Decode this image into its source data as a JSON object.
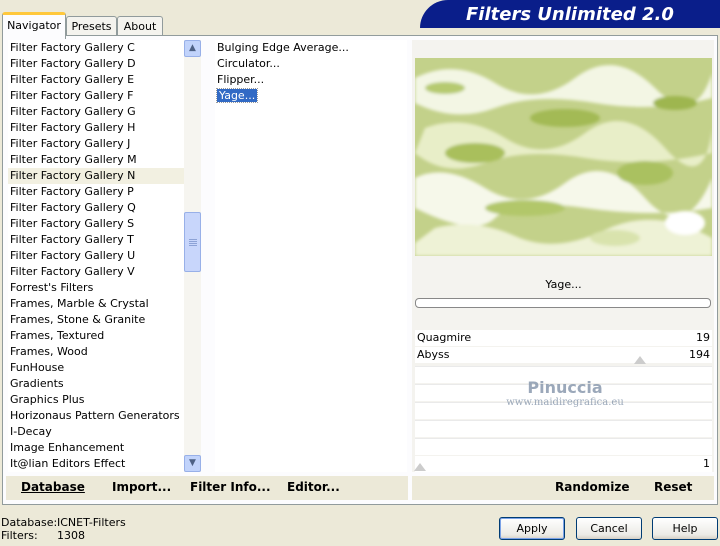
{
  "window": {
    "title_banner": "Filters Unlimited 2.0"
  },
  "tabs": [
    {
      "label": "Navigator",
      "active": true
    },
    {
      "label": "Presets",
      "active": false
    },
    {
      "label": "About",
      "active": false
    }
  ],
  "categories": {
    "items": [
      "Filter Factory Gallery C",
      "Filter Factory Gallery D",
      "Filter Factory Gallery E",
      "Filter Factory Gallery F",
      "Filter Factory Gallery G",
      "Filter Factory Gallery H",
      "Filter Factory Gallery J",
      "Filter Factory Gallery M",
      "Filter Factory Gallery N",
      "Filter Factory Gallery P",
      "Filter Factory Gallery Q",
      "Filter Factory Gallery S",
      "Filter Factory Gallery T",
      "Filter Factory Gallery U",
      "Filter Factory Gallery V",
      "Forrest's Filters",
      "Frames, Marble & Crystal",
      "Frames, Stone & Granite",
      "Frames, Textured",
      "Frames, Wood",
      "FunHouse",
      "Gradients",
      "Graphics Plus",
      "Horizonaus Pattern Generators",
      "I-Decay",
      "Image Enhancement",
      "It@lian Editors Effect"
    ],
    "highlighted": "Filter Factory Gallery N"
  },
  "filters": {
    "items": [
      "Bulging Edge Average...",
      "Circulator...",
      "Flipper...",
      "Yage..."
    ],
    "selected": "Yage..."
  },
  "left_buttons": [
    {
      "label": "Database"
    },
    {
      "label": "Import..."
    },
    {
      "label": "Filter Info..."
    },
    {
      "label": "Editor..."
    }
  ],
  "right_buttons": [
    {
      "label": "Randomize"
    },
    {
      "label": "Reset"
    }
  ],
  "preview": {
    "filter_name": "Yage...",
    "progress": 0
  },
  "sliders": [
    {
      "label": "Quagmire",
      "value": "19"
    },
    {
      "label": "Abyss",
      "value": "194"
    }
  ],
  "last_slider_value": "1",
  "watermark": {
    "line1": "Pinuccia",
    "line2": "www.maidiregrafica.eu"
  },
  "footer": {
    "database_label": "Database:",
    "database_value": "ICNET-Filters",
    "filters_label": "Filters:",
    "filters_value": "1308"
  },
  "dialog_buttons": [
    {
      "label": "Apply"
    },
    {
      "label": "Cancel"
    },
    {
      "label": "Help"
    }
  ],
  "colors": {
    "banner": "#0a1e8a",
    "selection": "#316ac5",
    "preview_base": "#c6d48a"
  }
}
